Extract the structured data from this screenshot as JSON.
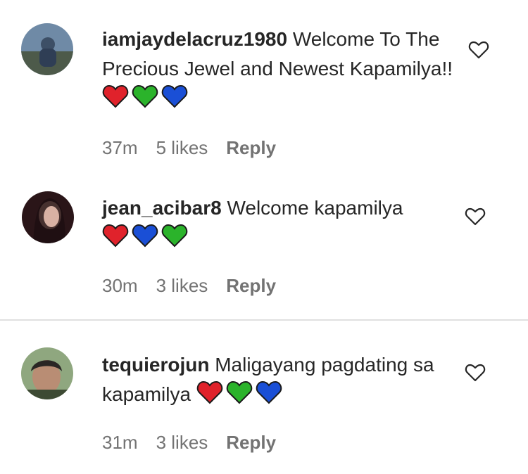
{
  "comments": [
    {
      "username": "iamjaydelacruz1980",
      "text": " Welcome To The Precious Jewel and Newest Kapamilya!! ",
      "time": "37m",
      "likes": "5 likes",
      "reply": "Reply",
      "hearts": [
        "red-heart-icon",
        "green-heart-icon",
        "blue-heart-icon"
      ]
    },
    {
      "username": "jean_acibar8",
      "text": " Welcome kapamilya ",
      "time": "30m",
      "likes": "3 likes",
      "reply": "Reply",
      "hearts": [
        "red-heart-icon",
        "blue-heart-icon",
        "green-heart-icon"
      ]
    },
    {
      "username": "tequierojun",
      "text": " Maligayang pagdating sa kapamilya ",
      "time": "31m",
      "likes": "3 likes",
      "reply": "Reply",
      "hearts": [
        "red-heart-icon",
        "green-heart-icon",
        "blue-heart-icon"
      ]
    }
  ],
  "colors": {
    "red_heart": "#e0222b",
    "green_heart": "#2bb32b",
    "blue_heart": "#1a4fd6",
    "meta_text": "#737373",
    "divider": "#e0e0e0"
  }
}
